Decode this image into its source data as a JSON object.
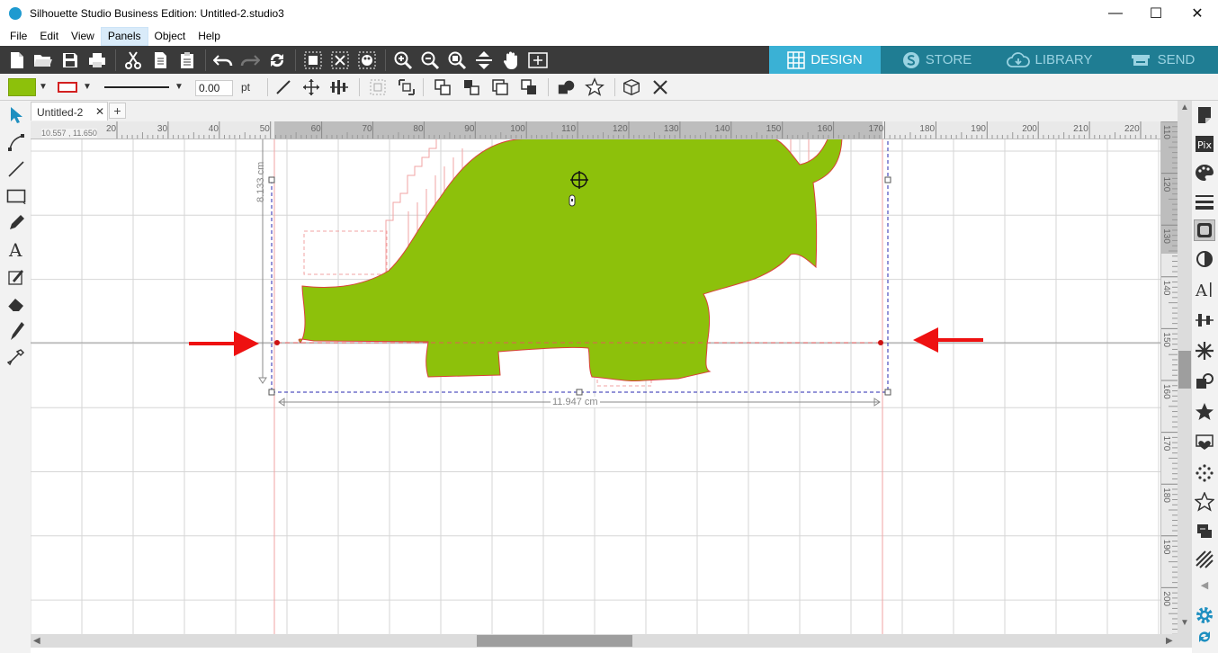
{
  "window": {
    "title": "Silhouette Studio Business Edition: Untitled-2.studio3",
    "minimize": "—",
    "maximize": "☐",
    "close": "✕"
  },
  "menu": {
    "items": [
      "File",
      "Edit",
      "View",
      "Panels",
      "Object",
      "Help"
    ],
    "active": "Panels"
  },
  "nav_tabs": {
    "design": "DESIGN",
    "store": "STORE",
    "library": "LIBRARY",
    "send": "SEND"
  },
  "colors": {
    "accent": "#3ab1d5",
    "tab_dark": "#1f7d93",
    "fill": "#8dc10b",
    "line": "#d32020",
    "arrow_annotation": "#ee1111"
  },
  "line_settings": {
    "width": "0.00",
    "unit": "pt"
  },
  "document": {
    "tab_label": "Untitled-2",
    "tab_close": "✕",
    "new_tab": "+"
  },
  "ruler": {
    "coord_readout": "10.557 , 11.650",
    "top_labels": [
      "20",
      "30",
      "40",
      "50",
      "60",
      "70",
      "80",
      "90",
      "100",
      "110",
      "120",
      "130",
      "140",
      "150",
      "160",
      "170",
      "180",
      "190",
      "200",
      "210",
      "220"
    ],
    "right_labels": [
      "110",
      "120",
      "130",
      "140",
      "150",
      "160",
      "170",
      "180",
      "190",
      "200"
    ]
  },
  "selection": {
    "height_label": "8.133 cm",
    "width_label": "11.947 cm"
  }
}
